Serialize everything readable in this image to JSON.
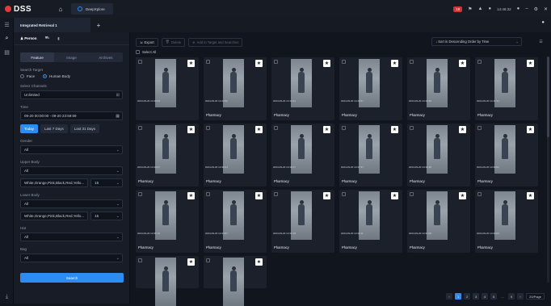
{
  "titlebar": {
    "logo": "DSS",
    "app_tab": "DeepXplore",
    "alarm_count": "18",
    "time": "14:46:32"
  },
  "tabbar": {
    "active_tab": "Integrated Retrieval 1"
  },
  "panel": {
    "target_tabs": [
      "Person",
      "",
      ""
    ],
    "segments": [
      "Feature",
      "Image",
      "Archives"
    ],
    "search_target_label": "Search Target",
    "search_target_options": [
      "Face",
      "Human Body"
    ],
    "select_channels_label": "Select Channels",
    "channels_value": "Unlimited",
    "time_label": "Time",
    "time_value": "09-20 00:00:00 - 09-20 23:59:59",
    "quick_ranges": [
      "Today",
      "Last 7 Days",
      "Last 31 Days"
    ],
    "gender_label": "Gender",
    "gender_value": "All",
    "upper_body_label": "Upper Body",
    "upper_body_value": "All",
    "upper_color_value": "White,Orange,Pink,Black,Red,Yello...",
    "upper_color_count": "15",
    "lower_body_label": "Lower Body",
    "lower_body_value": "All",
    "lower_color_value": "White,Orange,Pink,Black,Red,Yello...",
    "lower_color_count": "15",
    "hat_label": "Hat",
    "hat_value": "All",
    "bag_label": "Bag",
    "bag_value": "All",
    "search_button": "Search"
  },
  "toolbar": {
    "export": "Export",
    "delete": "Delete",
    "add_to_target": "Add to Target and Searches",
    "select_all": "Select All",
    "sort": "Sort in Descending Order by Time"
  },
  "results": [
    {
      "time": "2024-09-20 14:45:03",
      "location": ""
    },
    {
      "time": "2024-09-20 14:44:52",
      "location": "Pharmacy"
    },
    {
      "time": "2024-09-20 14:44:31",
      "location": "Pharmacy"
    },
    {
      "time": "2024-09-20 14:43:57",
      "location": "Pharmacy"
    },
    {
      "time": "2024-09-20 14:43:26",
      "location": "Pharmacy"
    },
    {
      "time": "2024-09-20 14:41:51",
      "location": "Pharmacy"
    },
    {
      "time": "2024-09-20 14:40:07",
      "location": "Pharmacy"
    },
    {
      "time": "2024-09-20 14:39:21",
      "location": "Pharmacy"
    },
    {
      "time": "2024-09-20 14:38:17",
      "location": "Pharmacy"
    },
    {
      "time": "2024-09-20 14:37:37",
      "location": "Pharmacy"
    },
    {
      "time": "2024-09-20 14:36:48",
      "location": "Pharmacy"
    },
    {
      "time": "2024-09-20 14:36:02",
      "location": "Pharmacy"
    },
    {
      "time": "2024-09-20 14:35:10",
      "location": "Pharmacy"
    },
    {
      "time": "2024-09-20 14:34:57",
      "location": "Pharmacy"
    },
    {
      "time": "2024-09-20 14:33:18",
      "location": "Pharmacy"
    },
    {
      "time": "2024-09-20 14:32:11",
      "location": "Pharmacy"
    },
    {
      "time": "2024-09-20 14:31:08",
      "location": "Pharmacy"
    },
    {
      "time": "2024-09-20 14:30:09",
      "location": "Pharmacy"
    },
    {
      "time": "",
      "location": ""
    },
    {
      "time": "",
      "location": ""
    }
  ],
  "pager": {
    "pages": [
      "1",
      "2",
      "3",
      "4",
      "5",
      "...",
      "9"
    ],
    "page_size": "20/Page"
  }
}
